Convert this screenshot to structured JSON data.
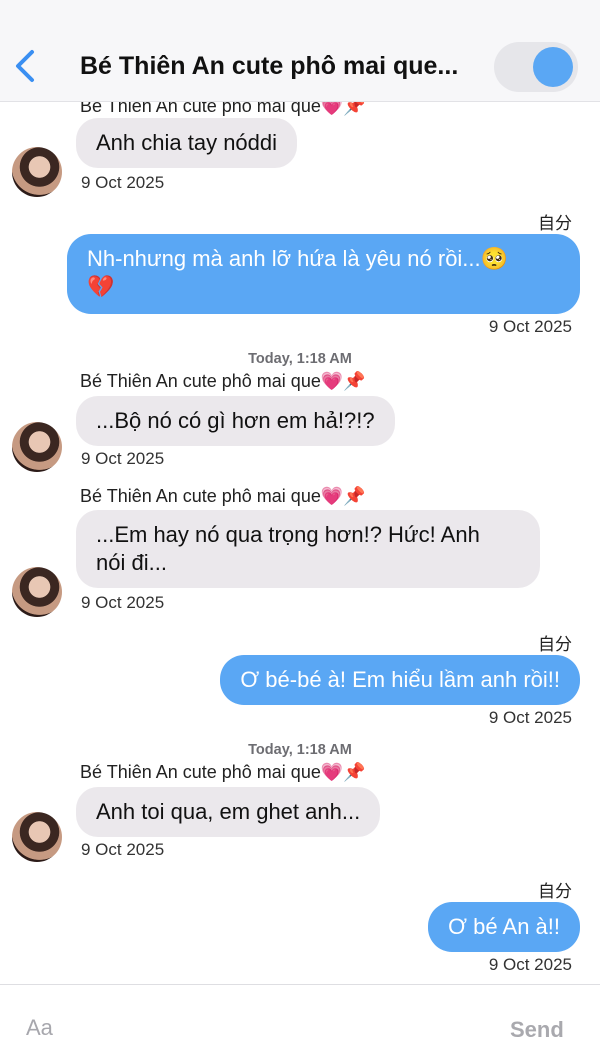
{
  "header": {
    "back_icon": "chevron-left-icon",
    "title": "Bé Thiên An cute phô mai que...",
    "toggle_on": true,
    "accent_color": "#5aa7f4"
  },
  "self_label": "自分",
  "messages": [
    {
      "direction": "incoming",
      "sender": "Bé Thiên An cute phô mai que💗📌",
      "text": "Anh chia tay nóddi",
      "date": "9 Oct 2025"
    },
    {
      "direction": "outgoing",
      "text_line1": "Nh-nhưng mà anh lỡ hứa là yêu nó rồi...🥺",
      "text_line2": "💔",
      "date": "9 Oct 2025"
    },
    {
      "direction": "incoming",
      "timestamp": "Today, 1:18 AM",
      "sender": "Bé Thiên An cute phô mai que💗📌",
      "text": "...Bộ nó có gì hơn em hả!?!?",
      "date": "9 Oct 2025"
    },
    {
      "direction": "incoming",
      "sender": "Bé Thiên An cute phô mai que💗📌",
      "text_line1": "...Em hay nó qua trọng hơn!? Hức! Anh",
      "text_line2": "nói đi...",
      "date": "9 Oct 2025"
    },
    {
      "direction": "outgoing",
      "text": "Ơ bé-bé à! Em hiểu lầm anh rồi!!",
      "date": "9 Oct 2025"
    },
    {
      "direction": "incoming",
      "timestamp": "Today, 1:18 AM",
      "sender": "Bé Thiên An cute phô mai que💗📌",
      "text": "Anh toi qua, em ghet anh...",
      "date": "9 Oct 2025"
    },
    {
      "direction": "outgoing",
      "text": "Ơ bé An à!!",
      "date": "9 Oct 2025"
    }
  ],
  "composer": {
    "placeholder": "Aa",
    "send_label": "Send"
  }
}
